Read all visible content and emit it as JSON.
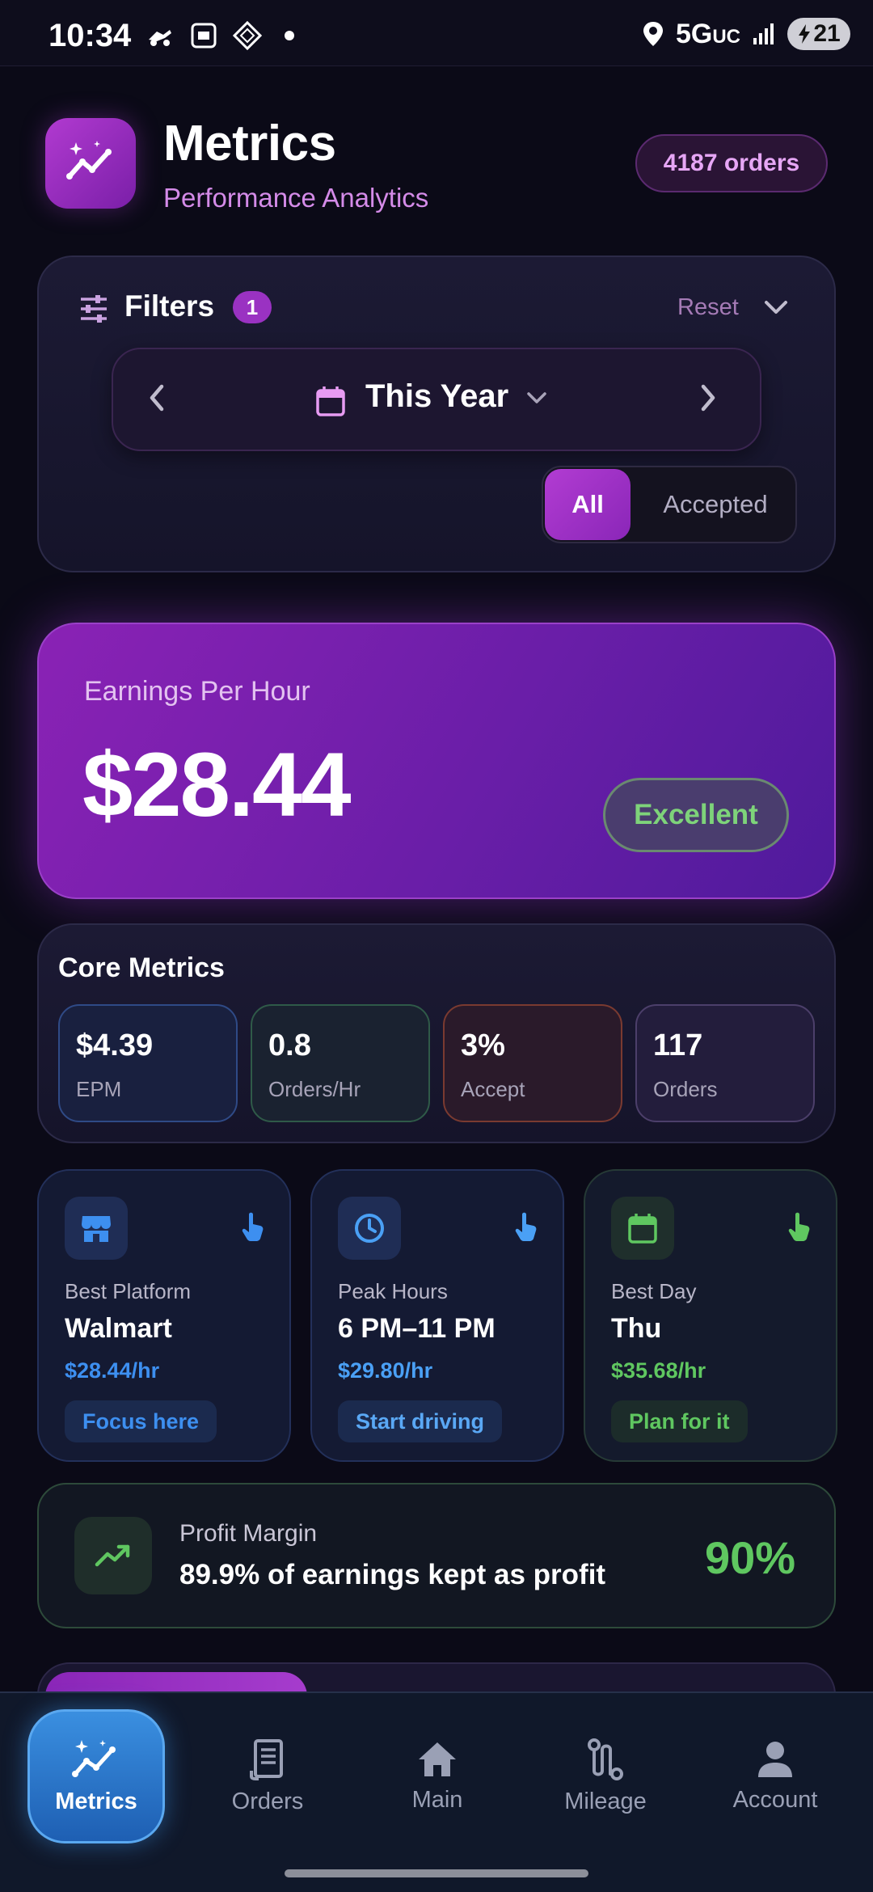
{
  "status_bar": {
    "time": "10:34",
    "network": "5G",
    "network_suffix": "UC",
    "battery": "21"
  },
  "header": {
    "title": "Metrics",
    "subtitle": "Performance Analytics",
    "orders_count": "4187 orders"
  },
  "filters": {
    "label": "Filters",
    "badge_count": "1",
    "reset_label": "Reset",
    "date_range": "This Year",
    "segments": [
      {
        "label": "All",
        "selected": true
      },
      {
        "label": "Accepted",
        "selected": false
      }
    ]
  },
  "earnings": {
    "label": "Earnings Per Hour",
    "value": "$28.44",
    "rating": "Excellent"
  },
  "core_metrics": {
    "title": "Core Metrics",
    "items": [
      {
        "value": "$4.39",
        "label": "EPM"
      },
      {
        "value": "0.8",
        "label": "Orders/Hr"
      },
      {
        "value": "3%",
        "label": "Accept"
      },
      {
        "value": "117",
        "label": "Orders"
      }
    ]
  },
  "insights": [
    {
      "label": "Best Platform",
      "value": "Walmart",
      "rate": "$28.44/hr",
      "action": "Focus here",
      "icon": "store-icon"
    },
    {
      "label": "Peak Hours",
      "value": "6 PM–11 PM",
      "rate": "$29.80/hr",
      "action": "Start driving",
      "icon": "clock-icon"
    },
    {
      "label": "Best Day",
      "value": "Thu",
      "rate": "$35.68/hr",
      "action": "Plan for it",
      "icon": "calendar-icon"
    }
  ],
  "profit": {
    "label": "Profit Margin",
    "description": "89.9% of earnings kept as profit",
    "value": "90%"
  },
  "nav": [
    {
      "label": "Metrics",
      "active": true
    },
    {
      "label": "Orders",
      "active": false
    },
    {
      "label": "Main",
      "active": false
    },
    {
      "label": "Mileage",
      "active": false
    },
    {
      "label": "Account",
      "active": false
    }
  ],
  "colors": {
    "accent_purple": "#9a32c2",
    "accent_blue": "#3a8fe0",
    "positive_green": "#5fc760",
    "background": "#0b0a17"
  }
}
